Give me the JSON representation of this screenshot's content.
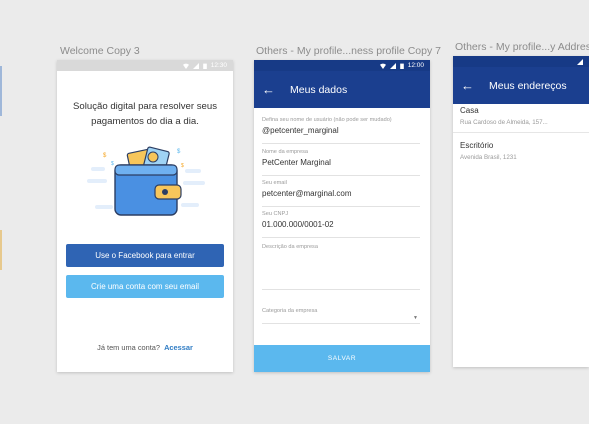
{
  "artboards": {
    "welcome": "Welcome Copy 3",
    "profile": "Others - My profile...ness profile Copy 7",
    "addresses": "Others - My profile...y Addresse"
  },
  "welcome": {
    "clock": "12:30",
    "headline_1": "Solução digital para resolver seus",
    "headline_2": "pagamentos do dia a dia.",
    "facebook_button": "Use o Facebook para entrar",
    "email_button": "Crie uma conta com seu email",
    "login_prompt": "Já tem uma conta?",
    "login_link": "Acessar"
  },
  "profile": {
    "clock": "12:00",
    "title": "Meus dados",
    "fields": [
      {
        "label": "Defina seu nome de usuário (não pode ser mudado)",
        "value": "@petcenter_marginal"
      },
      {
        "label": "Nome da empresa",
        "value": "PetCenter Marginal"
      },
      {
        "label": "Seu email",
        "value": "petcenter@marginal.com"
      },
      {
        "label": "Seu CNPJ",
        "value": "01.000.000/0001-02"
      },
      {
        "label": "Descrição da empresa",
        "value": ""
      },
      {
        "label": "Categoria da empresa",
        "value": ""
      }
    ],
    "save_button": "SALVAR"
  },
  "addresses": {
    "title": "Meus endereços",
    "items": [
      {
        "name": "Casa",
        "address": "Rua Cardoso de Almeida, 157..."
      },
      {
        "name": "Escritório",
        "address": "Avenida Brasil, 1231"
      }
    ]
  },
  "colors": {
    "primary": "#1b3f8f",
    "facebook": "#2f64b4",
    "accent": "#5bb8ee",
    "link": "#2f7cc4"
  },
  "icons": [
    "back-arrow-icon",
    "wifi-icon",
    "signal-icon",
    "battery-icon",
    "dropdown-arrow-icon",
    "wallet-illustration"
  ]
}
